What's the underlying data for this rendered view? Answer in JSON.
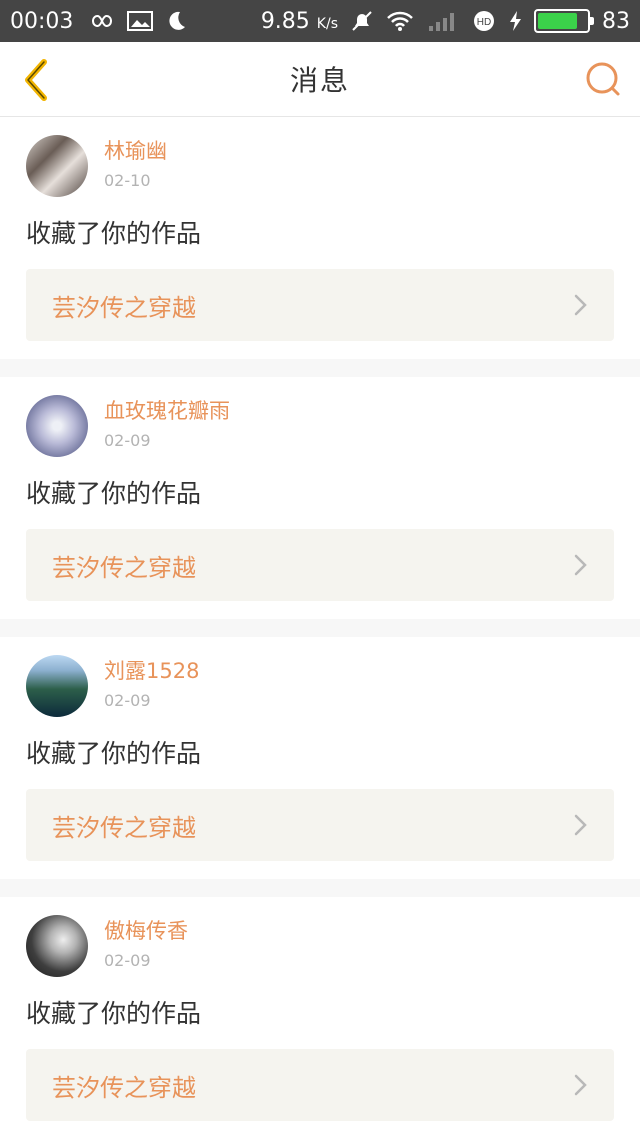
{
  "status_bar": {
    "time": "00:03",
    "speed": "9.85",
    "speed_unit": "K/s",
    "battery_level": "83"
  },
  "header": {
    "title": "消息"
  },
  "messages": [
    {
      "name": "林瑜幽",
      "date": "02-10",
      "action": "收藏了你的作品",
      "work": "芸汐传之穿越"
    },
    {
      "name": "血玫瑰花瓣雨",
      "date": "02-09",
      "action": "收藏了你的作品",
      "work": "芸汐传之穿越"
    },
    {
      "name": "刘露1528",
      "date": "02-09",
      "action": "收藏了你的作品",
      "work": "芸汐传之穿越"
    },
    {
      "name": "傲梅传香",
      "date": "02-09",
      "action": "收藏了你的作品",
      "work": "芸汐传之穿越"
    }
  ],
  "colors": {
    "accent": "#e8935a",
    "back_icon": "#f2b400",
    "card_bg": "#f5f4ef",
    "status_bar_bg": "#454545"
  },
  "icons": {
    "back": "chevron-left-icon",
    "search": "search-icon",
    "item_arrow": "chevron-right-icon"
  }
}
